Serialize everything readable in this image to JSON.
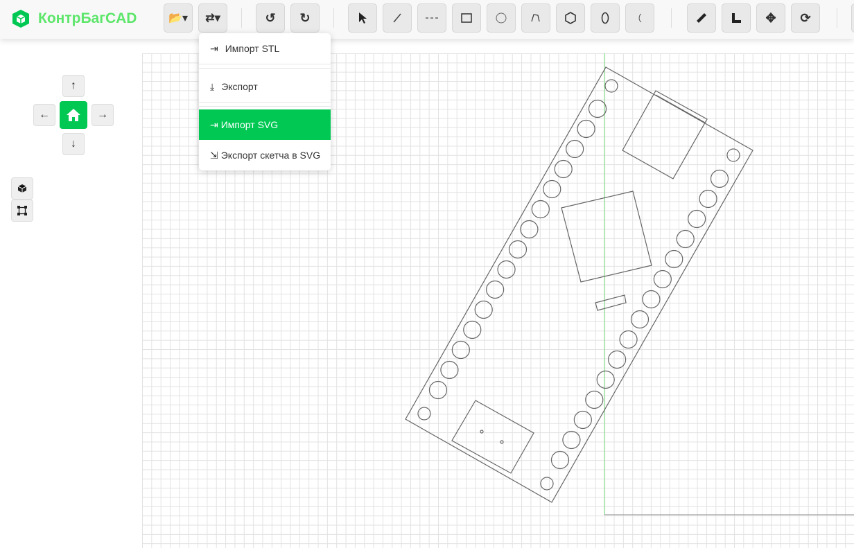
{
  "app": {
    "title": "КонтрБагCAD",
    "accent": "#00c853"
  },
  "toolbar": {
    "buttons": [
      "folder-open",
      "import-export",
      "undo",
      "redo",
      "select",
      "line",
      "dashed-line",
      "rectangle",
      "circle",
      "polyline",
      "hexagon",
      "ellipse",
      "arc",
      "ruler",
      "measure-angle",
      "move",
      "rotate"
    ]
  },
  "menu": {
    "items": [
      {
        "label": "Импорт STL",
        "icon": "file-import-icon"
      },
      {
        "label": "Экспорт",
        "icon": "download-icon"
      },
      {
        "label": "Импорт SVG",
        "icon": "file-import-icon",
        "active": true
      },
      {
        "label": "Экспорт скетча в SVG",
        "icon": "file-export-icon"
      }
    ]
  }
}
